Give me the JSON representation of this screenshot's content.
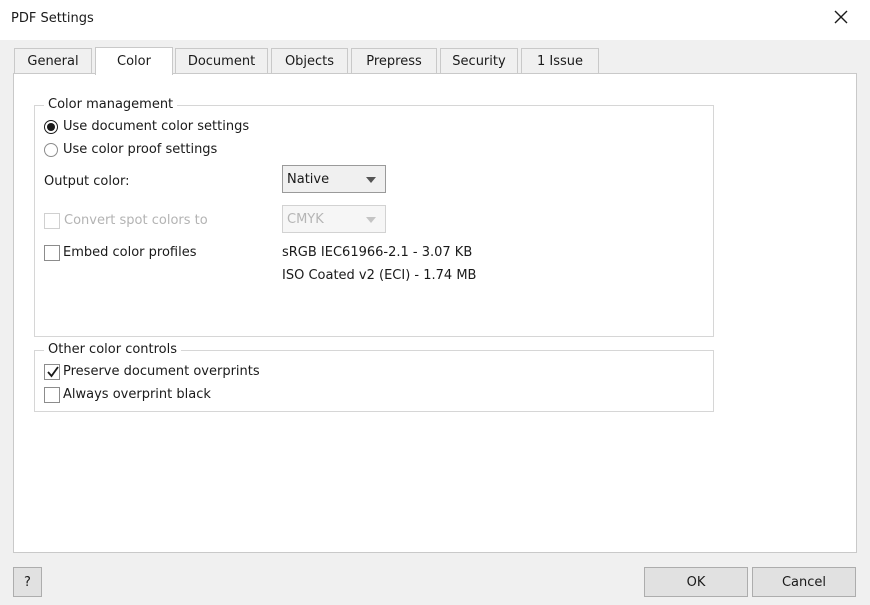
{
  "window": {
    "title": "PDF Settings",
    "close_icon": "close-icon"
  },
  "tabs": [
    {
      "label": "General"
    },
    {
      "label": "Color",
      "active": true
    },
    {
      "label": "Document"
    },
    {
      "label": "Objects"
    },
    {
      "label": "Prepress"
    },
    {
      "label": "Security"
    },
    {
      "label": "1 Issue"
    }
  ],
  "color_management": {
    "legend": "Color management",
    "radio_document": {
      "label": "Use document color settings",
      "checked": true
    },
    "radio_proof": {
      "label": "Use color proof settings",
      "checked": false
    },
    "output_color": {
      "label": "Output color:",
      "value": "Native"
    },
    "convert_spot": {
      "label": "Convert spot colors to",
      "checked": false,
      "enabled": false,
      "value": "CMYK"
    },
    "embed_profiles": {
      "label": "Embed color profiles",
      "checked": false
    },
    "profiles": [
      "sRGB IEC61966-2.1 - 3.07 KB",
      "ISO Coated v2 (ECI) - 1.74 MB"
    ]
  },
  "other_controls": {
    "legend": "Other color controls",
    "preserve_overprints": {
      "label": "Preserve document overprints",
      "checked": true
    },
    "overprint_black": {
      "label": "Always overprint black",
      "checked": false
    }
  },
  "buttons": {
    "help": "?",
    "ok": "OK",
    "cancel": "Cancel"
  }
}
